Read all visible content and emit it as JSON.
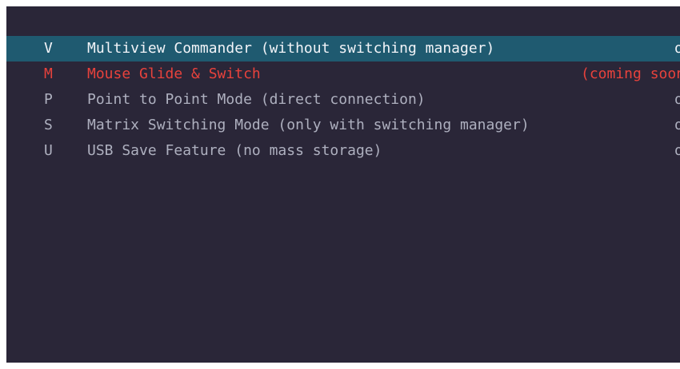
{
  "menu": {
    "items": [
      {
        "key": "V",
        "label": "Multiview Commander (without switching manager)",
        "status": "o",
        "selected": true
      },
      {
        "key": "M",
        "label": "Mouse Glide & Switch",
        "status": "(coming soon",
        "highlighted": true
      },
      {
        "key": "P",
        "label": "Point to Point Mode (direct connection)",
        "status": "o"
      },
      {
        "key": "S",
        "label": "Matrix Switching Mode (only with switching manager)",
        "status": "o"
      },
      {
        "key": "U",
        "label": "USB Save Feature (no mass storage)",
        "status": "o"
      }
    ]
  },
  "colors": {
    "background": "#2a2638",
    "selected_row": "#1f5a70",
    "selected_text": "#f2f4f8",
    "normal_text": "#aeb0bf",
    "highlight_text": "#e8423c"
  }
}
